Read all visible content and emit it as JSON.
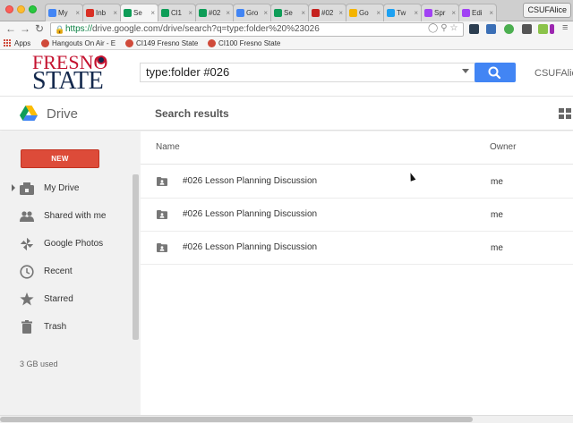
{
  "browser": {
    "tabs": [
      {
        "label": "My",
        "color": "#4285f4"
      },
      {
        "label": "Inb",
        "color": "#d93025"
      },
      {
        "label": "Se",
        "color": "#0f9d58",
        "active": true
      },
      {
        "label": "Cl1",
        "color": "#0f9d58"
      },
      {
        "label": "#02",
        "color": "#0f9d58"
      },
      {
        "label": "Gro",
        "color": "#4285f4"
      },
      {
        "label": "Se",
        "color": "#0f9d58"
      },
      {
        "label": "#02",
        "color": "#c5221f"
      },
      {
        "label": "Go",
        "color": "#f4b400"
      },
      {
        "label": "Tw",
        "color": "#1da1f2"
      },
      {
        "label": "Spr",
        "color": "#a142f4"
      },
      {
        "label": "Edi",
        "color": "#a142f4"
      }
    ],
    "tab_close": "×",
    "profile": "CSUFAlice",
    "url_scheme": "https://",
    "url_rest": "drive.google.com/drive/search?q=type:folder%20%23026",
    "bookmarks": {
      "apps": "Apps",
      "items": [
        "Hangouts On Air - E",
        "CI149 Fresno State",
        "CI100 Fresno State"
      ]
    }
  },
  "header": {
    "logo_line1": "FRESNO",
    "logo_line2": "STATE",
    "search_value": "type:folder #026",
    "account": "CSUFAlice"
  },
  "subheader": {
    "app_name": "Drive",
    "page_title": "Search results"
  },
  "sidebar": {
    "new_button": "NEW",
    "items": [
      {
        "label": "My Drive",
        "icon": "my-drive-icon"
      },
      {
        "label": "Shared with me",
        "icon": "shared-people-icon"
      },
      {
        "label": "Google Photos",
        "icon": "photos-pinwheel-icon"
      },
      {
        "label": "Recent",
        "icon": "clock-icon"
      },
      {
        "label": "Starred",
        "icon": "star-icon"
      },
      {
        "label": "Trash",
        "icon": "trash-icon"
      }
    ],
    "storage": "3 GB used"
  },
  "list": {
    "col_name": "Name",
    "col_owner": "Owner",
    "rows": [
      {
        "name": "#026 Lesson Planning Discussion",
        "owner": "me"
      },
      {
        "name": "#026 Lesson Planning Discussion",
        "owner": "me"
      },
      {
        "name": "#026 Lesson Planning Discussion",
        "owner": "me"
      }
    ]
  },
  "colors": {
    "new_button": "#dd4b39",
    "search_button": "#4285f4",
    "brand_red": "#c4122f",
    "brand_navy": "#13284c"
  }
}
